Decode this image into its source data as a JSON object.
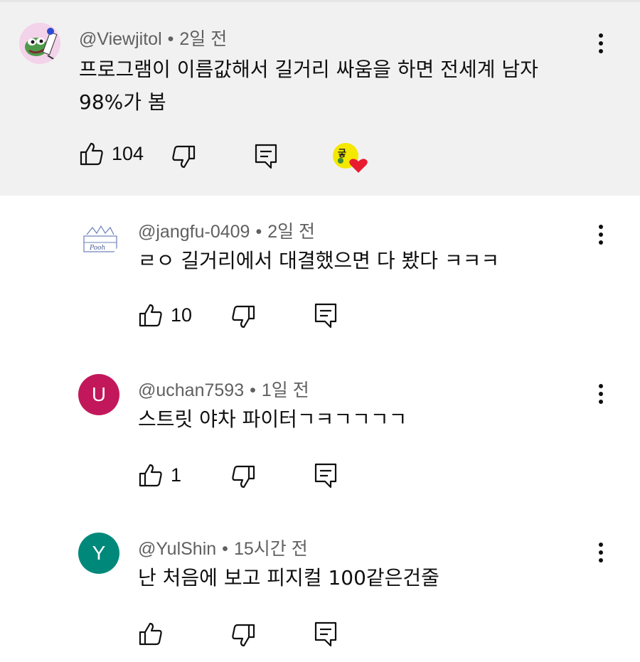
{
  "comments": [
    {
      "author": "@Viewjitol",
      "time": "2일 전",
      "text_line1": "프로그램이 이름값해서 길거리 싸움을 하면 전세계 남자",
      "text_line2": "98%가 봄",
      "likes": "104",
      "avatar_icon": "frog-character-avatar",
      "highlighted": true,
      "creator_heart": true
    },
    {
      "author": "@jangfu-0409",
      "time": "2일 전",
      "text": "ㄹㅇ 길거리에서 대결했으면 다 봤다 ㅋㅋㅋ",
      "likes": "10",
      "avatar_icon": "pooh-sketch-avatar",
      "avatar_label": "Pooh"
    },
    {
      "author": "@uchan7593",
      "time": "1일 전",
      "text": "스트릿 야차 파이터ㄱㅋㄱㄱㄱㄱ",
      "likes": "1",
      "avatar_letter": "U",
      "avatar_color": "#c2185b"
    },
    {
      "author": "@YulShin",
      "time": "15시간 전",
      "text": "난 처음에 보고 피지컬 100같은건줄",
      "likes": "",
      "avatar_letter": "Y",
      "avatar_color": "#00897b"
    }
  ],
  "separator": "•"
}
